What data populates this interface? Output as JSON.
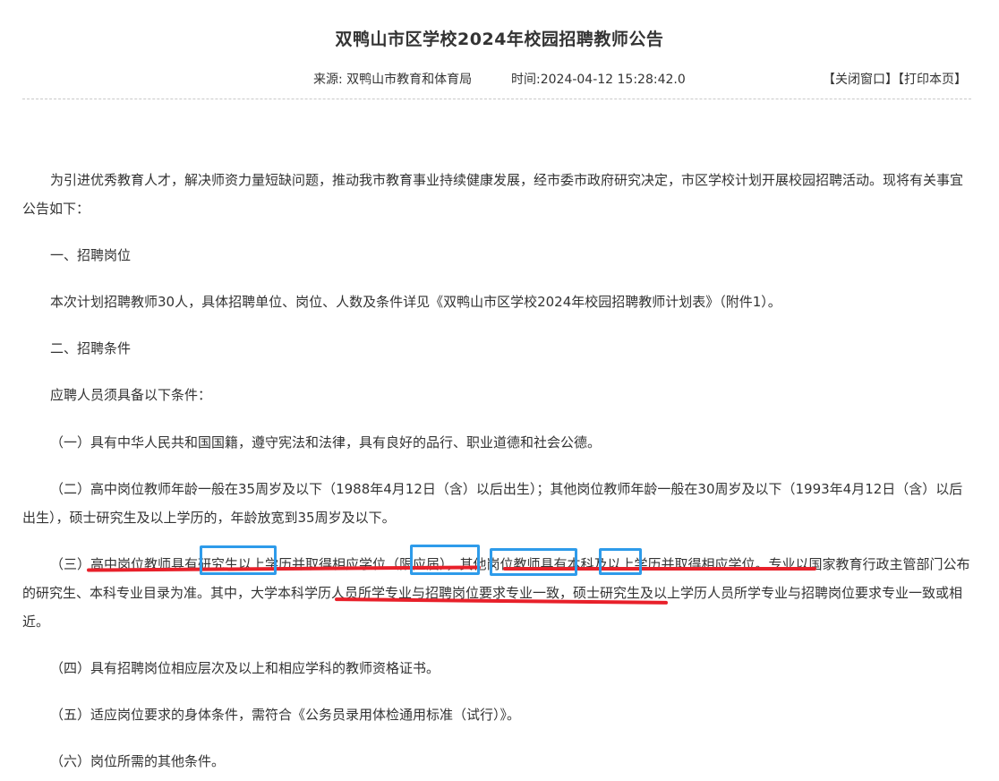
{
  "article": {
    "title": "双鸭山市区学校2024年校园招聘教师公告",
    "source": "来源: 双鸭山市教育和体育局",
    "time": "时间:2024-04-12 15:28:42.0",
    "close_window": "【关闭窗口】",
    "print_page": "【打印本页】"
  },
  "content": {
    "intro": "为引进优秀教育人才，解决师资力量短缺问题，推动我市教育事业持续健康发展，经市委市政府研究决定，市区学校计划开展校园招聘活动。现将有关事宜公告如下：",
    "section1_heading": "一、招聘岗位",
    "section1_text": "本次计划招聘教师30人，具体招聘单位、岗位、人数及条件详见《双鸭山市区学校2024年校园招聘教师计划表》（附件1）。",
    "section2_heading": "二、招聘条件",
    "section2_lead": "应聘人员须具备以下条件：",
    "cond1": "（一）具有中华人民共和国国籍，遵守宪法和法律，具有良好的品行、职业道德和社会公德。",
    "cond2": "（二）高中岗位教师年龄一般在35周岁及以下（1988年4月12日（含）以后出生）；其他岗位教师年龄一般在30周岁及以下（1993年4月12日（含）以后出生），硕士研究生及以上学历的，年龄放宽到35周岁及以下。",
    "cond3": "（三）高中岗位教师具有研究生以上学历并取得相应学位（限应届），其他岗位教师具有本科及以上学历并取得相应学位。专业以国家教育行政主管部门公布的研究生、本科专业目录为准。其中，大学本科学历人员所学专业与招聘岗位要求专业一致，硕士研究生及以上学历人员所学专业与招聘岗位要求专业一致或相近。",
    "cond4": "（四）具有招聘岗位相应层次及以上和相应学科的教师资格证书。",
    "cond5": "（五）适应岗位要求的身体条件，需符合《公务员录用体检通用标准（试行）》。",
    "cond6": "（六）岗位所需的其他条件。"
  },
  "annotation_colors": {
    "underline": "#e8202a",
    "box": "#2e9bea"
  }
}
